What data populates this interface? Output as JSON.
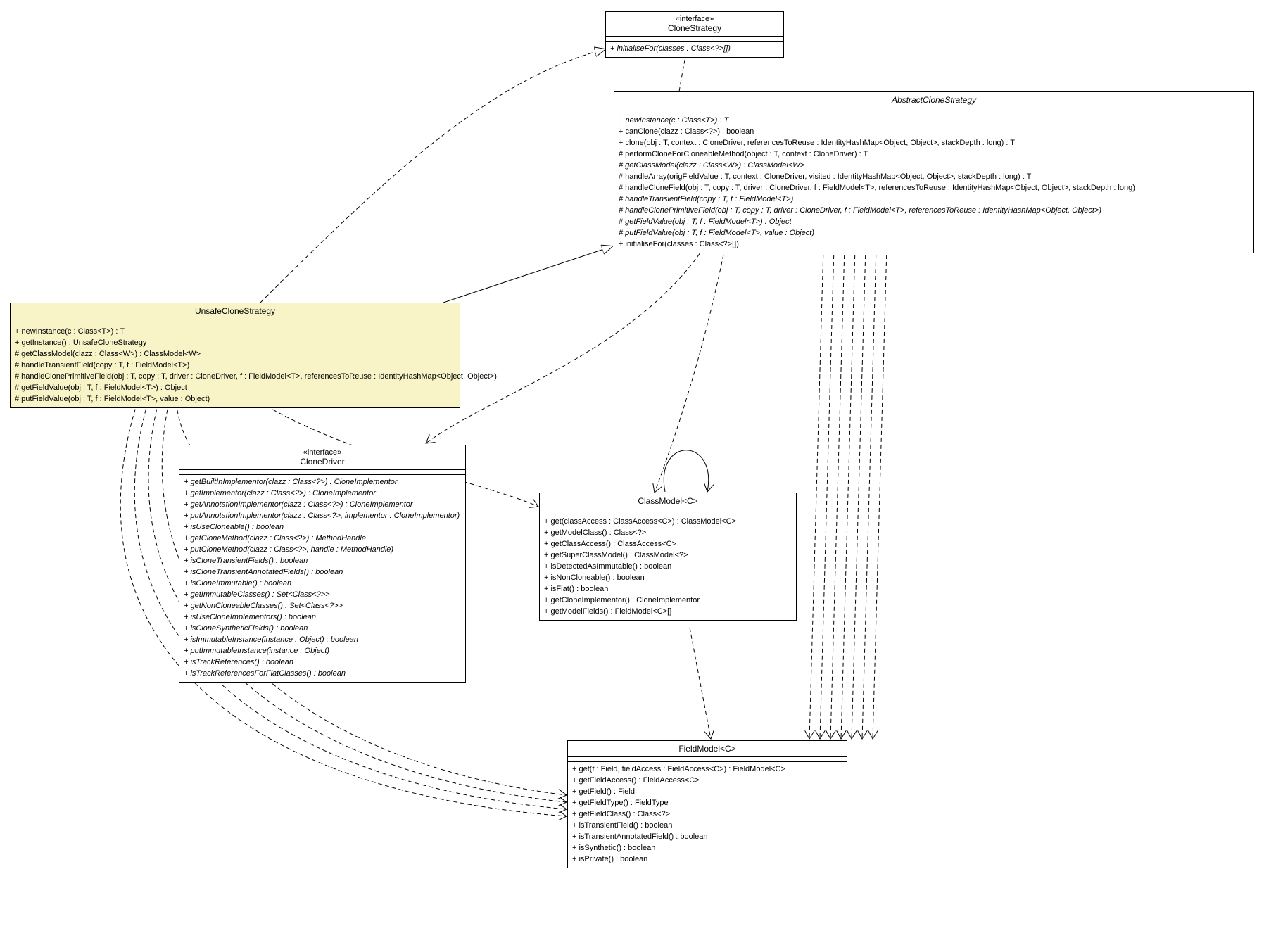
{
  "classes": {
    "cloneStrategy": {
      "stereotype": "«interface»",
      "name": "CloneStrategy",
      "ops": [
        "+ initialiseFor(classes : Class<?>[])"
      ]
    },
    "abstractCloneStrategy": {
      "name": "AbstractCloneStrategy",
      "abstract": true,
      "ops": [
        "+ newInstance(c : Class<T>) : T",
        "+ canClone(clazz : Class<?>) : boolean",
        "+ clone(obj : T, context : CloneDriver, referencesToReuse : IdentityHashMap<Object, Object>, stackDepth : long) : T",
        "# performCloneForCloneableMethod(object : T, context : CloneDriver) : T",
        "# getClassModel(clazz : Class<W>) : ClassModel<W>",
        "# handleArray(origFieldValue : T, context : CloneDriver, visited : IdentityHashMap<Object, Object>, stackDepth : long) : T",
        "# handleCloneField(obj : T, copy : T, driver : CloneDriver, f : FieldModel<T>, referencesToReuse : IdentityHashMap<Object, Object>, stackDepth : long)",
        "# handleTransientField(copy : T, f : FieldModel<T>)",
        "# handleClonePrimitiveField(obj : T, copy : T, driver : CloneDriver, f : FieldModel<T>, referencesToReuse : IdentityHashMap<Object, Object>)",
        "# getFieldValue(obj : T, f : FieldModel<T>) : Object",
        "# putFieldValue(obj : T, f : FieldModel<T>, value : Object)",
        "+ initialiseFor(classes : Class<?>[])"
      ]
    },
    "unsafeCloneStrategy": {
      "name": "UnsafeCloneStrategy",
      "highlighted": true,
      "ops": [
        "+ newInstance(c : Class<T>) : T",
        "+ getInstance() : UnsafeCloneStrategy",
        "# getClassModel(clazz : Class<W>) : ClassModel<W>",
        "# handleTransientField(copy : T, f : FieldModel<T>)",
        "# handleClonePrimitiveField(obj : T, copy : T, driver : CloneDriver, f : FieldModel<T>, referencesToReuse : IdentityHashMap<Object, Object>)",
        "# getFieldValue(obj : T, f : FieldModel<T>) : Object",
        "# putFieldValue(obj : T, f : FieldModel<T>, value : Object)"
      ]
    },
    "cloneDriver": {
      "stereotype": "«interface»",
      "name": "CloneDriver",
      "ops": [
        "+ getBuiltInImplementor(clazz : Class<?>) : CloneImplementor",
        "+ getImplementor(clazz : Class<?>) : CloneImplementor",
        "+ getAnnotationImplementor(clazz : Class<?>) : CloneImplementor",
        "+ putAnnotationImplementor(clazz : Class<?>, implementor : CloneImplementor)",
        "+ isUseCloneable() : boolean",
        "+ getCloneMethod(clazz : Class<?>) : MethodHandle",
        "+ putCloneMethod(clazz : Class<?>, handle : MethodHandle)",
        "+ isCloneTransientFields() : boolean",
        "+ isCloneTransientAnnotatedFields() : boolean",
        "+ isCloneImmutable() : boolean",
        "+ getImmutableClasses() : Set<Class<?>>",
        "+ getNonCloneableClasses() : Set<Class<?>>",
        "+ isUseCloneImplementors() : boolean",
        "+ isCloneSyntheticFields() : boolean",
        "+ isImmutableInstance(instance : Object) : boolean",
        "+ putImmutableInstance(instance : Object)",
        "+ isTrackReferences() : boolean",
        "+ isTrackReferencesForFlatClasses() : boolean"
      ]
    },
    "classModel": {
      "name": "ClassModel<C>",
      "ops": [
        "+ get(classAccess : ClassAccess<C>) : ClassModel<C>",
        "+ getModelClass() : Class<?>",
        "+ getClassAccess() : ClassAccess<C>",
        "+ getSuperClassModel() : ClassModel<?>",
        "+ isDetectedAsImmutable() : boolean",
        "+ isNonCloneable() : boolean",
        "+ isFlat() : boolean",
        "+ getCloneImplementor() : CloneImplementor",
        "+ getModelFields() : FieldModel<C>[]"
      ]
    },
    "fieldModel": {
      "name": "FieldModel<C>",
      "ops": [
        "+ get(f : Field, fieldAccess : FieldAccess<C>) : FieldModel<C>",
        "+ getFieldAccess() : FieldAccess<C>",
        "+ getField() : Field",
        "+ getFieldType() : FieldType",
        "+ getFieldClass() : Class<?>",
        "+ isTransientField() : boolean",
        "+ isTransientAnnotatedField() : boolean",
        "+ isSynthetic() : boolean",
        "+ isPrivate() : boolean"
      ]
    }
  }
}
